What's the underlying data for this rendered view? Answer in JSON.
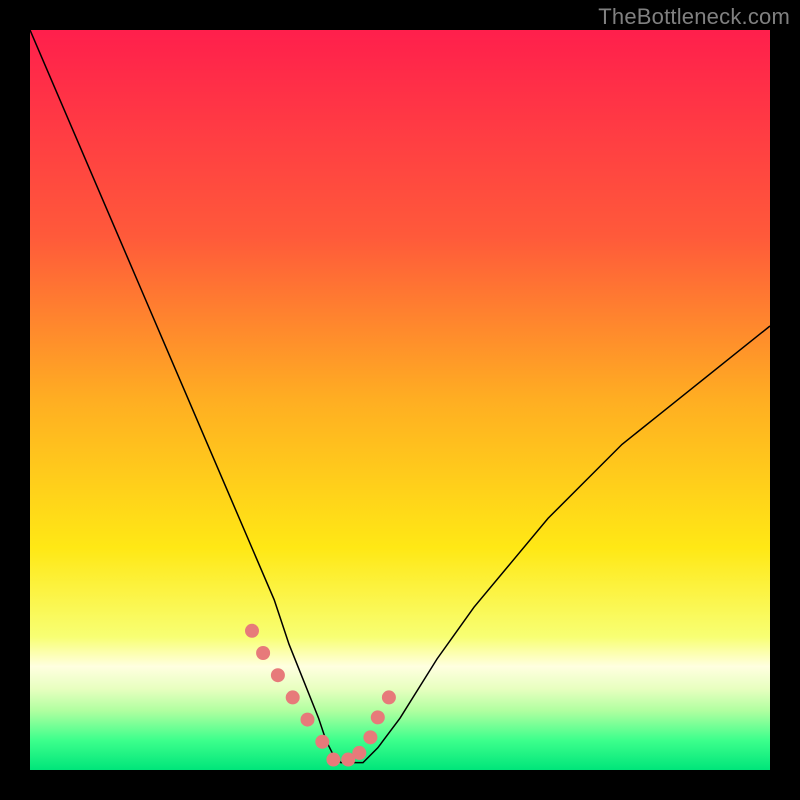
{
  "watermark": "TheBottleneck.com",
  "chart_data": {
    "type": "line",
    "title": "",
    "xlabel": "",
    "ylabel": "",
    "xlim": [
      0,
      100
    ],
    "ylim": [
      0,
      100
    ],
    "grid": false,
    "legend": false,
    "background_gradient_stops": [
      {
        "offset": 0,
        "color": "#ff1f4c"
      },
      {
        "offset": 28,
        "color": "#ff5a3a"
      },
      {
        "offset": 50,
        "color": "#ffae22"
      },
      {
        "offset": 70,
        "color": "#ffe815"
      },
      {
        "offset": 82,
        "color": "#f8ff73"
      },
      {
        "offset": 86,
        "color": "#ffffe0"
      },
      {
        "offset": 89,
        "color": "#e8ffc0"
      },
      {
        "offset": 92,
        "color": "#b0ffa0"
      },
      {
        "offset": 96,
        "color": "#3cff8c"
      },
      {
        "offset": 100,
        "color": "#00e57a"
      }
    ],
    "series": [
      {
        "name": "bottleneck-curve",
        "stroke": "#000000",
        "stroke_width": 1.5,
        "x": [
          0,
          3,
          6,
          9,
          12,
          15,
          18,
          21,
          24,
          27,
          30,
          33,
          35,
          37,
          39,
          40,
          41,
          42,
          43,
          45,
          47,
          50,
          55,
          60,
          65,
          70,
          75,
          80,
          85,
          90,
          95,
          100
        ],
        "y": [
          100,
          93,
          86,
          79,
          72,
          65,
          58,
          51,
          44,
          37,
          30,
          23,
          17,
          12,
          7,
          4,
          2,
          1,
          1,
          1,
          3,
          7,
          15,
          22,
          28,
          34,
          39,
          44,
          48,
          52,
          56,
          60
        ]
      }
    ],
    "markers": {
      "name": "efficiency-markers",
      "color": "#e77a7a",
      "radius": 7,
      "x": [
        30.0,
        31.5,
        33.5,
        35.5,
        37.5,
        39.5,
        41.0,
        43.0,
        44.5,
        46.0,
        47.0,
        48.5
      ],
      "y": [
        30.0,
        25.0,
        20.0,
        15.0,
        10.0,
        5.0,
        1.0,
        1.0,
        2.5,
        6.0,
        10.5,
        15.0
      ]
    }
  }
}
